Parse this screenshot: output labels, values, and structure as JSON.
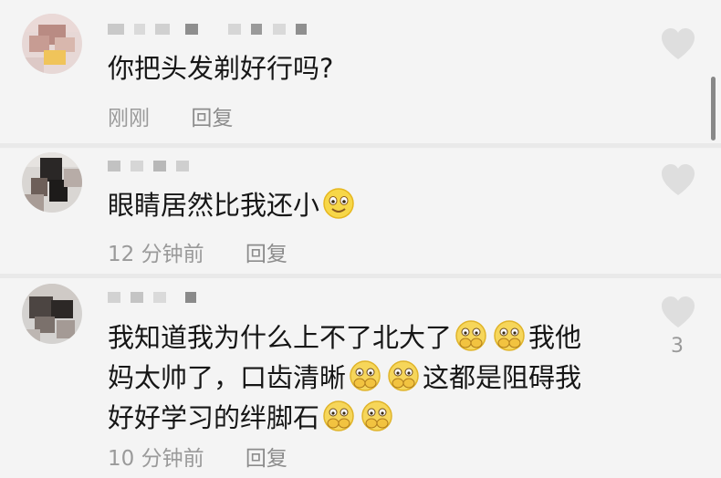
{
  "colors": {
    "background": "#f4f4f4",
    "text": "#161616",
    "meta": "#9a9a9a",
    "heart": "#dcdcdc"
  },
  "comments": [
    {
      "text": "你把头发剃好行吗?",
      "time": "刚刚",
      "reply": "回复",
      "icon": "heart-icon"
    },
    {
      "text": "眼睛居然比我还小",
      "time": "12 分钟前",
      "reply": "回复",
      "icon": "heart-icon",
      "emoji": "smile-emoji"
    },
    {
      "lines": [
        "我知道我为什么上不了北大了",
        "我他",
        "妈太帅了，口齿清晰",
        "这都是阻碍我",
        "好好学习的绊脚石"
      ],
      "time": "10 分钟前",
      "reply": "回复",
      "likes": "3",
      "icon": "heart-icon",
      "emoji": "shy-emoji"
    }
  ]
}
